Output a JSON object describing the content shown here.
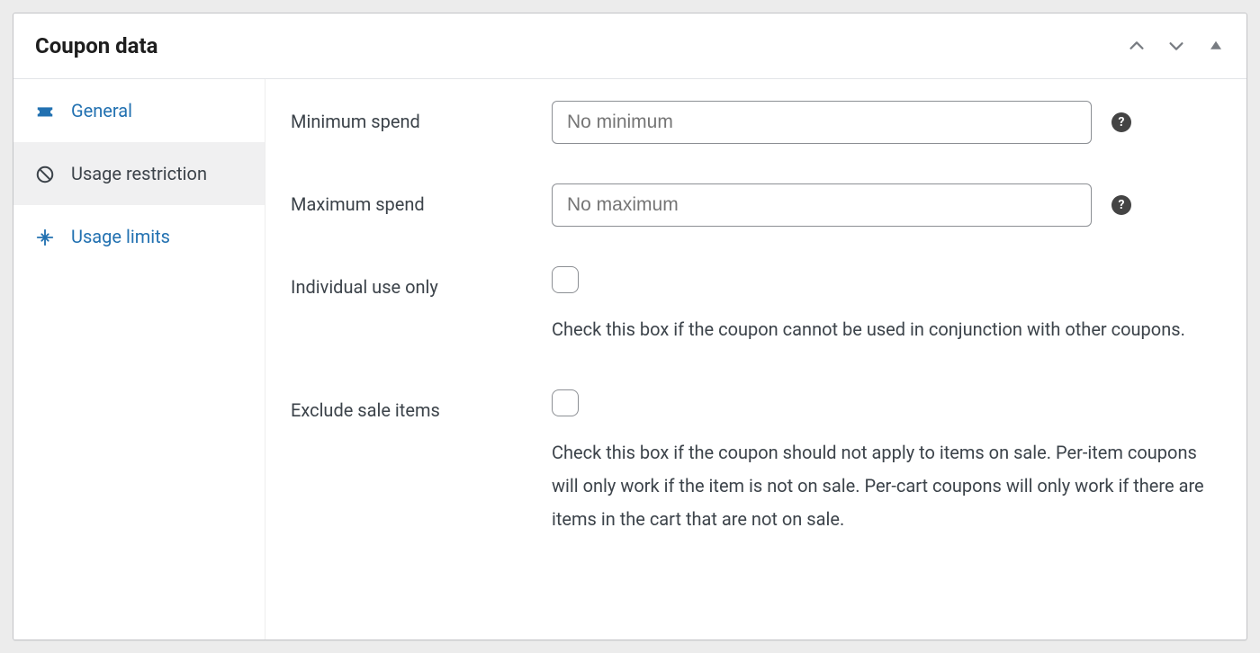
{
  "panel": {
    "title": "Coupon data"
  },
  "sidebar": {
    "tabs": [
      {
        "label": "General",
        "icon": "ticket-icon",
        "active": false
      },
      {
        "label": "Usage restriction",
        "icon": "block-icon",
        "active": true
      },
      {
        "label": "Usage limits",
        "icon": "arrows-collapse-icon",
        "active": false
      }
    ]
  },
  "form": {
    "minimum_spend": {
      "label": "Minimum spend",
      "placeholder": "No minimum",
      "value": ""
    },
    "maximum_spend": {
      "label": "Maximum spend",
      "placeholder": "No maximum",
      "value": ""
    },
    "individual_use": {
      "label": "Individual use only",
      "checked": false,
      "description": "Check this box if the coupon cannot be used in conjunction with other coupons."
    },
    "exclude_sale_items": {
      "label": "Exclude sale items",
      "checked": false,
      "description": "Check this box if the coupon should not apply to items on sale. Per-item coupons will only work if the item is not on sale. Per-cart coupons will only work if there are items in the cart that are not on sale."
    }
  },
  "icons": {
    "help_glyph": "?"
  }
}
